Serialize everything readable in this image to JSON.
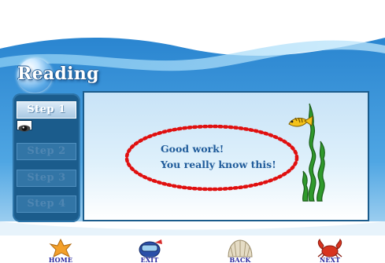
{
  "title": "Reading",
  "steps": [
    {
      "label": "Step 1",
      "active": true
    },
    {
      "label": "Step 2",
      "active": false
    },
    {
      "label": "Step 3",
      "active": false
    },
    {
      "label": "Step 4",
      "active": false
    }
  ],
  "message": {
    "line1": "Good work!",
    "line2": "You really know this!"
  },
  "nav": {
    "home": "HOME",
    "exit": "EXIT",
    "back": "BACK",
    "next": "NEXT"
  },
  "icons": {
    "eye": "eye-icon",
    "fish": "fish-icon",
    "seaweed": "seaweed-icon",
    "home": "starfish-icon",
    "exit": "diver-helmet-icon",
    "back": "clam-shell-icon",
    "next": "crab-icon"
  },
  "colors": {
    "sea_blue": "#2f86cf",
    "panel_blue": "#1b5c8c",
    "message_text": "#1f5b9a",
    "dotted_ellipse": "#e01010",
    "nav_text": "#2a2aa0"
  }
}
